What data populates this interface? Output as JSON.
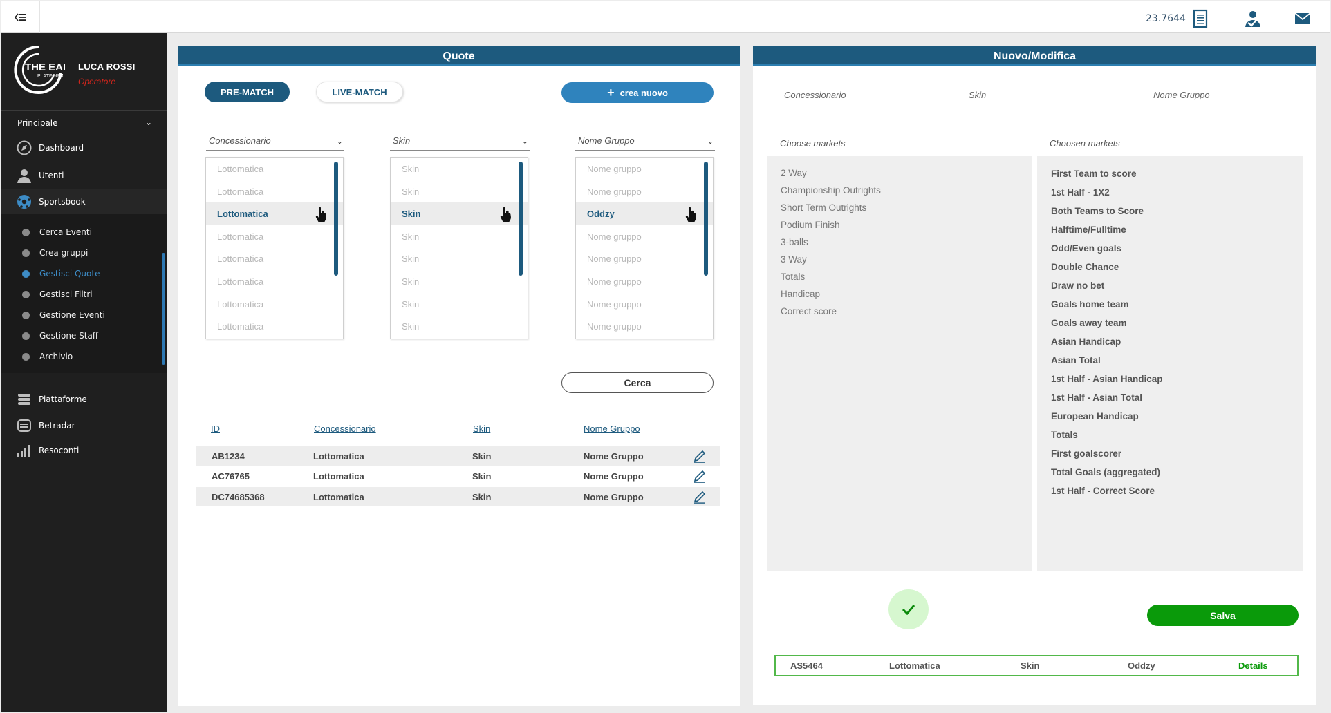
{
  "header": {
    "menu_icon": "menu-collapse-icon",
    "balance": "23.7644",
    "icons": [
      "receipt-icon",
      "user-transfer-icon",
      "mail-icon"
    ]
  },
  "sidebar": {
    "user_name": "LUCA ROSSI",
    "user_role": "Operatore",
    "logo_text": "THE EAR",
    "logo_subtext": "PLATFORM",
    "section": "Principale",
    "items": [
      {
        "label": "Dashboard",
        "icon": "compass-icon"
      },
      {
        "label": "Utenti",
        "icon": "user-icon"
      },
      {
        "label": "Sportsbook",
        "icon": "soccer-ball-icon"
      }
    ],
    "sub_items": [
      {
        "label": "Cerca Eventi"
      },
      {
        "label": "Crea gruppi"
      },
      {
        "label": "Gestisci Quote"
      },
      {
        "label": "Gestisci Filtri"
      },
      {
        "label": "Gestione Eventi"
      },
      {
        "label": "Gestione Staff"
      },
      {
        "label": "Archivio"
      }
    ],
    "bottom_items": [
      {
        "label": "Piattaforme",
        "icon": "stack-icon"
      },
      {
        "label": "Betradar",
        "icon": "server-icon"
      },
      {
        "label": "Resoconti",
        "icon": "bar-chart-icon"
      }
    ],
    "active_color": "#3d8cc6"
  },
  "quote_panel": {
    "title": "Quote",
    "tab_prematch": "PRE-MATCH",
    "tab_livematch": "LIVE-MATCH",
    "create_button": "crea nuovo",
    "dropdowns": [
      {
        "label": "Concessionario",
        "options": [
          "Lottomatica",
          "Lottomatica",
          "Lottomatica",
          "Lottomatica",
          "Lottomatica",
          "Lottomatica",
          "Lottomatica",
          "Lottomatica"
        ],
        "selected_index": 2
      },
      {
        "label": "Skin",
        "options": [
          "Skin",
          "Skin",
          "Skin",
          "Skin",
          "Skin",
          "Skin",
          "Skin",
          "Skin"
        ],
        "selected_index": 2
      },
      {
        "label": "Nome Gruppo",
        "options": [
          "Nome gruppo",
          "Nome gruppo",
          "Oddzy",
          "Nome gruppo",
          "Nome gruppo",
          "Nome gruppo",
          "Nome gruppo",
          "Nome gruppo"
        ],
        "selected_index": 2
      }
    ],
    "search_button": "Cerca",
    "table": {
      "headers": [
        "ID",
        "Concessionario",
        "Skin",
        "Nome Gruppo"
      ],
      "rows": [
        {
          "id": "AB1234",
          "concessionario": "Lottomatica",
          "skin": "Skin",
          "gruppo": "Nome Gruppo"
        },
        {
          "id": "AC76765",
          "concessionario": "Lottomatica",
          "skin": "Skin",
          "gruppo": "Nome Gruppo"
        },
        {
          "id": "DC74685368",
          "concessionario": "Lottomatica",
          "skin": "Skin",
          "gruppo": "Nome Gruppo"
        }
      ]
    },
    "brand_color": "#1d5a7e"
  },
  "edit_panel": {
    "title": "Nuovo/Modifica",
    "fields": {
      "concessionario": "Concessionario",
      "skin": "Skin",
      "nome_gruppo": "Nome Gruppo"
    },
    "choose_title": "Choose markets",
    "chosen_title": "Choosen markets",
    "choose_markets": [
      "2 Way",
      "Championship Outrights",
      "Short Term Outrights",
      "Podium Finish",
      "3-balls",
      "3 Way",
      "Totals",
      "Handicap",
      "Correct score"
    ],
    "chosen_markets": [
      "First Team to score",
      "1st Half - 1X2",
      "Both Teams to Score",
      "Halftime/Fulltime",
      "Odd/Even goals",
      "Double Chance",
      "Draw no bet",
      "Goals home team",
      "Goals away team",
      "Asian Handicap",
      "Asian Total",
      "1st Half - Asian Handicap",
      "1st Half - Asian Total",
      "European Handicap",
      "Totals",
      "First goalscorer",
      "Total Goals (aggregated)",
      "1st Half - Correct Score"
    ],
    "save_button": "Salva",
    "result": {
      "id": "AS5464",
      "concessionario": "Lottomatica",
      "skin": "Skin",
      "gruppo": "Oddzy",
      "details": "Details"
    },
    "success_color": "#0a9a0a"
  }
}
